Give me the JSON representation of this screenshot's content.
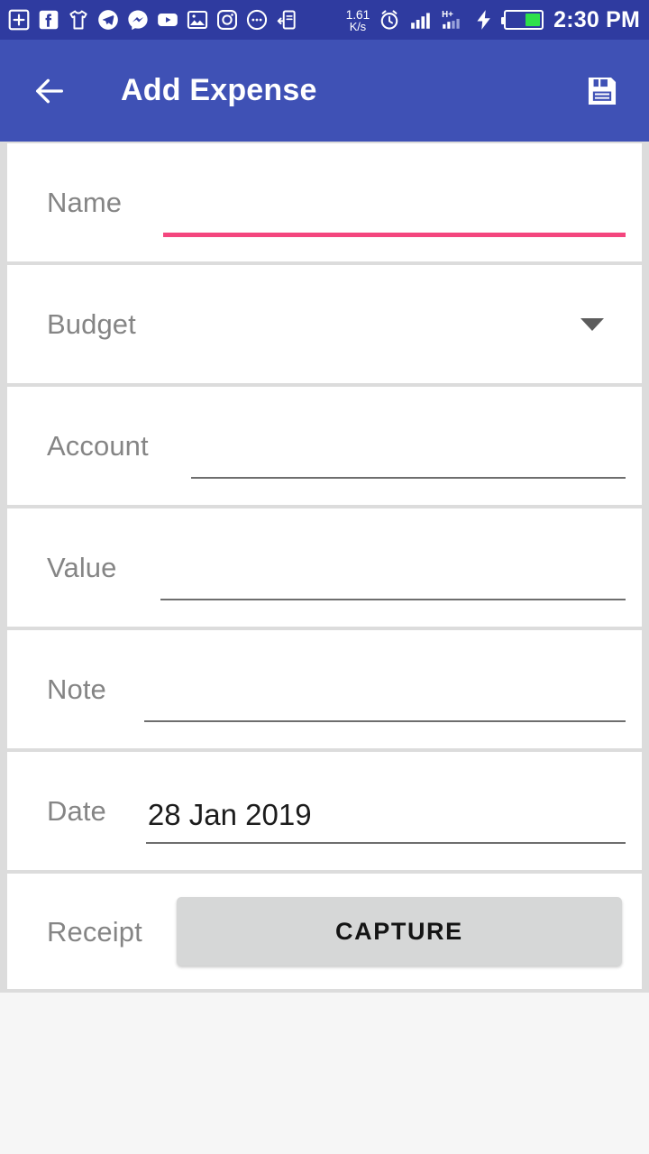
{
  "status_bar": {
    "notification_icons": [
      {
        "name": "plus-box-icon",
        "label": "Add"
      },
      {
        "name": "facebook-icon",
        "label": "Facebook"
      },
      {
        "name": "tshirt-icon",
        "label": "Shirt"
      },
      {
        "name": "telegram-icon",
        "label": "Telegram"
      },
      {
        "name": "messenger-icon",
        "label": "Messenger"
      },
      {
        "name": "youtube-icon",
        "label": "YouTube"
      },
      {
        "name": "gallery-icon",
        "label": "Gallery"
      },
      {
        "name": "instagram-icon",
        "label": "Instagram"
      },
      {
        "name": "chat-dots-icon",
        "label": "Chat"
      },
      {
        "name": "file-transfer-icon",
        "label": "Share"
      }
    ],
    "network_speed_value": "1.61",
    "network_speed_unit": "K/s",
    "alarm_icon": "alarm-clock-icon",
    "signal_1_icon": "signal-bars-icon",
    "signal_2_icon": "signal-hplus-icon",
    "network_type": "H+",
    "charging_icon": "charging-bolt-icon",
    "battery_icon": "battery-icon",
    "battery_level_percent": 45,
    "battery_color": "#2ee04a",
    "time": "2:30 PM",
    "background_color": "#2f3ba0"
  },
  "app_bar": {
    "back_icon": "back-arrow-icon",
    "title": "Add Expense",
    "save_icon": "save-floppy-icon",
    "background_color": "#3f51b5"
  },
  "form": {
    "accent_color": "#f4467e",
    "rows": [
      {
        "id": "name",
        "label": "Name",
        "type": "text",
        "value": "",
        "focused": true
      },
      {
        "id": "budget",
        "label": "Budget",
        "type": "dropdown",
        "value": "",
        "caret_icon": "chevron-down-icon"
      },
      {
        "id": "account",
        "label": "Account",
        "type": "text",
        "value": "",
        "focused": false
      },
      {
        "id": "value",
        "label": "Value",
        "type": "text",
        "value": "",
        "focused": false
      },
      {
        "id": "note",
        "label": "Note",
        "type": "text",
        "value": "",
        "focused": false
      },
      {
        "id": "date",
        "label": "Date",
        "type": "date",
        "value": "28 Jan 2019",
        "focused": false
      },
      {
        "id": "receipt",
        "label": "Receipt",
        "type": "button",
        "button_label": "CAPTURE"
      }
    ]
  }
}
